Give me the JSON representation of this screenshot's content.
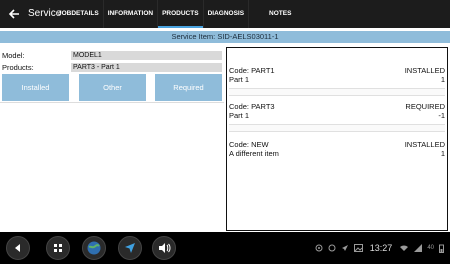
{
  "appbar": {
    "title": "Service",
    "tabs": [
      "JOBDETAILS",
      "INFORMATION",
      "PRODUCTS",
      "DIAGNOSIS",
      "NOTES"
    ],
    "active_tab": "PRODUCTS",
    "accent": "#4aa3df"
  },
  "service_item": "Service Item: SID-AELS03011-1",
  "form": {
    "model_label": "Model:",
    "model_value": "MODEL1",
    "products_label": "Products:",
    "products_value": "PART3 - Part 1"
  },
  "buttons": {
    "installed": "Installed",
    "other": "Other",
    "required": "Required",
    "color": "#8fbcda"
  },
  "items": [
    {
      "code": "Code: PART1",
      "status": "INSTALLED",
      "name": "Part 1",
      "qty": "1"
    },
    {
      "code": "Code: PART3",
      "status": "REQUIRED",
      "name": "Part 1",
      "qty": "-1"
    },
    {
      "code": "Code: NEW",
      "status": "INSTALLED",
      "name": "A different item",
      "qty": "1"
    }
  ],
  "status_bar": {
    "time": "13:27",
    "battery": "40",
    "icons": [
      "target-icon",
      "circle-icon",
      "navigation-icon",
      "image-icon",
      "wifi-icon",
      "signal-icon",
      "battery-icon"
    ]
  },
  "nav_icons": [
    "back-icon",
    "apps-icon",
    "globe-icon",
    "navigation-icon",
    "volume-icon"
  ]
}
